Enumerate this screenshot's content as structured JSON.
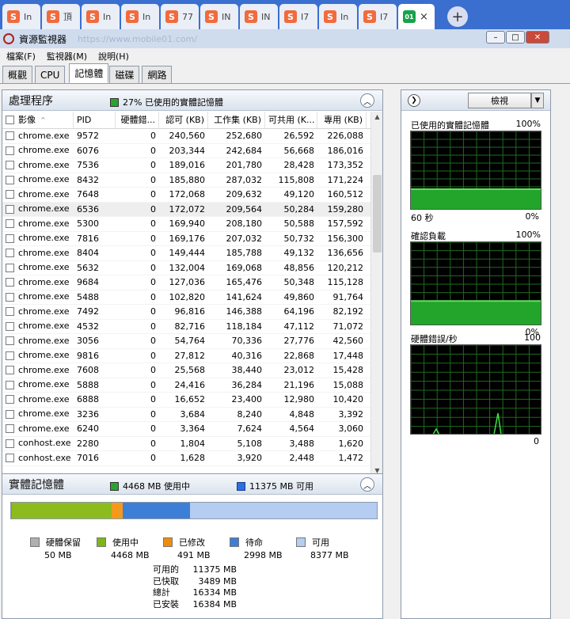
{
  "browser": {
    "tabs": [
      {
        "label": "In",
        "favicon": "S"
      },
      {
        "label": "頂",
        "favicon": "S"
      },
      {
        "label": "In",
        "favicon": "S"
      },
      {
        "label": "In",
        "favicon": "S"
      },
      {
        "label": "77",
        "favicon": "S"
      },
      {
        "label": "IN",
        "favicon": "S"
      },
      {
        "label": "IN",
        "favicon": "S"
      },
      {
        "label": "I7",
        "favicon": "S"
      },
      {
        "label": "In",
        "favicon": "S"
      },
      {
        "label": "I7",
        "favicon": "S"
      }
    ],
    "active_tab": {
      "favicon": "01",
      "close": "×"
    },
    "new_tab": "+"
  },
  "window": {
    "title": "資源監視器",
    "url_hint": "https://www.mobile01.com/"
  },
  "menu": [
    "檔案(F)",
    "監視器(M)",
    "說明(H)"
  ],
  "tabs": [
    "概觀",
    "CPU",
    "記憶體",
    "磁碟",
    "網路"
  ],
  "process_panel": {
    "title": "處理程序",
    "meter_text": "27% 已使用的實體記憶體",
    "columns": [
      "影像",
      "PID",
      "硬體錯...",
      "認可 (KB)",
      "工作集 (KB)",
      "可共用 (K...",
      "專用 (KB)"
    ],
    "rows": [
      [
        "chrome.exe",
        "9572",
        "0",
        "240,560",
        "252,680",
        "26,592",
        "226,088"
      ],
      [
        "chrome.exe",
        "6076",
        "0",
        "203,344",
        "242,684",
        "56,668",
        "186,016"
      ],
      [
        "chrome.exe",
        "7536",
        "0",
        "189,016",
        "201,780",
        "28,428",
        "173,352"
      ],
      [
        "chrome.exe",
        "8432",
        "0",
        "185,880",
        "287,032",
        "115,808",
        "171,224"
      ],
      [
        "chrome.exe",
        "7648",
        "0",
        "172,068",
        "209,632",
        "49,120",
        "160,512"
      ],
      [
        "chrome.exe",
        "6536",
        "0",
        "172,072",
        "209,564",
        "50,284",
        "159,280"
      ],
      [
        "chrome.exe",
        "5300",
        "0",
        "169,940",
        "208,180",
        "50,588",
        "157,592"
      ],
      [
        "chrome.exe",
        "7816",
        "0",
        "169,176",
        "207,032",
        "50,732",
        "156,300"
      ],
      [
        "chrome.exe",
        "8404",
        "0",
        "149,444",
        "185,788",
        "49,132",
        "136,656"
      ],
      [
        "chrome.exe",
        "5632",
        "0",
        "132,004",
        "169,068",
        "48,856",
        "120,212"
      ],
      [
        "chrome.exe",
        "9684",
        "0",
        "127,036",
        "165,476",
        "50,348",
        "115,128"
      ],
      [
        "chrome.exe",
        "5488",
        "0",
        "102,820",
        "141,624",
        "49,860",
        "91,764"
      ],
      [
        "chrome.exe",
        "7492",
        "0",
        "96,816",
        "146,388",
        "64,196",
        "82,192"
      ],
      [
        "chrome.exe",
        "4532",
        "0",
        "82,716",
        "118,184",
        "47,112",
        "71,072"
      ],
      [
        "chrome.exe",
        "3056",
        "0",
        "54,764",
        "70,336",
        "27,776",
        "42,560"
      ],
      [
        "chrome.exe",
        "9816",
        "0",
        "27,812",
        "40,316",
        "22,868",
        "17,448"
      ],
      [
        "chrome.exe",
        "7608",
        "0",
        "25,568",
        "38,440",
        "23,012",
        "15,428"
      ],
      [
        "chrome.exe",
        "5888",
        "0",
        "24,416",
        "36,284",
        "21,196",
        "15,088"
      ],
      [
        "chrome.exe",
        "6888",
        "0",
        "16,652",
        "23,400",
        "12,980",
        "10,420"
      ],
      [
        "chrome.exe",
        "3236",
        "0",
        "3,684",
        "8,240",
        "4,848",
        "3,392"
      ],
      [
        "chrome.exe",
        "6240",
        "0",
        "3,364",
        "7,624",
        "4,564",
        "3,060"
      ],
      [
        "conhost.exe",
        "2280",
        "0",
        "1,804",
        "5,108",
        "3,488",
        "1,620"
      ],
      [
        "conhost.exe",
        "7016",
        "0",
        "1,628",
        "3,920",
        "2,448",
        "1,472"
      ]
    ]
  },
  "memory_panel": {
    "title": "實體記憶體",
    "in_use_text": "4468 MB 使用中",
    "available_text": "11375 MB 可用",
    "bar": [
      {
        "name": "硬體保留",
        "mb": 50,
        "color": "#8a8a8a"
      },
      {
        "name": "使用中",
        "mb": 4468,
        "color": "#8dbb1e"
      },
      {
        "name": "已修改",
        "mb": 491,
        "color": "#f39a1a"
      },
      {
        "name": "待命",
        "mb": 2998,
        "color": "#3d7fd6"
      },
      {
        "name": "可用",
        "mb": 8377,
        "color": "#b4cdf0"
      }
    ],
    "legend": [
      {
        "label": "硬體保留",
        "value": "50 MB",
        "color": "#b0b0b0"
      },
      {
        "label": "使用中",
        "value": "4468 MB",
        "color": "#7fb51c"
      },
      {
        "label": "已修改",
        "value": "491 MB",
        "color": "#ee8c12"
      },
      {
        "label": "待命",
        "value": "2998 MB",
        "color": "#3d7fd6"
      },
      {
        "label": "可用",
        "value": "8377 MB",
        "color": "#b4cdf0"
      }
    ],
    "stats": [
      {
        "label": "可用的",
        "value": "11375 MB"
      },
      {
        "label": "已快取",
        "value": "3489 MB"
      },
      {
        "label": "總計",
        "value": "16334 MB"
      },
      {
        "label": "已安裝",
        "value": "16384 MB"
      }
    ]
  },
  "right_panel": {
    "view_label": "檢視",
    "graphs": [
      {
        "title": "已使用的實體記憶體",
        "max": "100%",
        "bottom_left": "60 秒",
        "bottom_right": "0%",
        "level": 0.27
      },
      {
        "title": "確認負載",
        "max": "100%",
        "bottom_left": "",
        "bottom_right": "0%",
        "level": 0.3
      },
      {
        "title": "硬體錯誤/秒",
        "max": "100",
        "bottom_left": "",
        "bottom_right": "0",
        "level": 0
      }
    ]
  }
}
